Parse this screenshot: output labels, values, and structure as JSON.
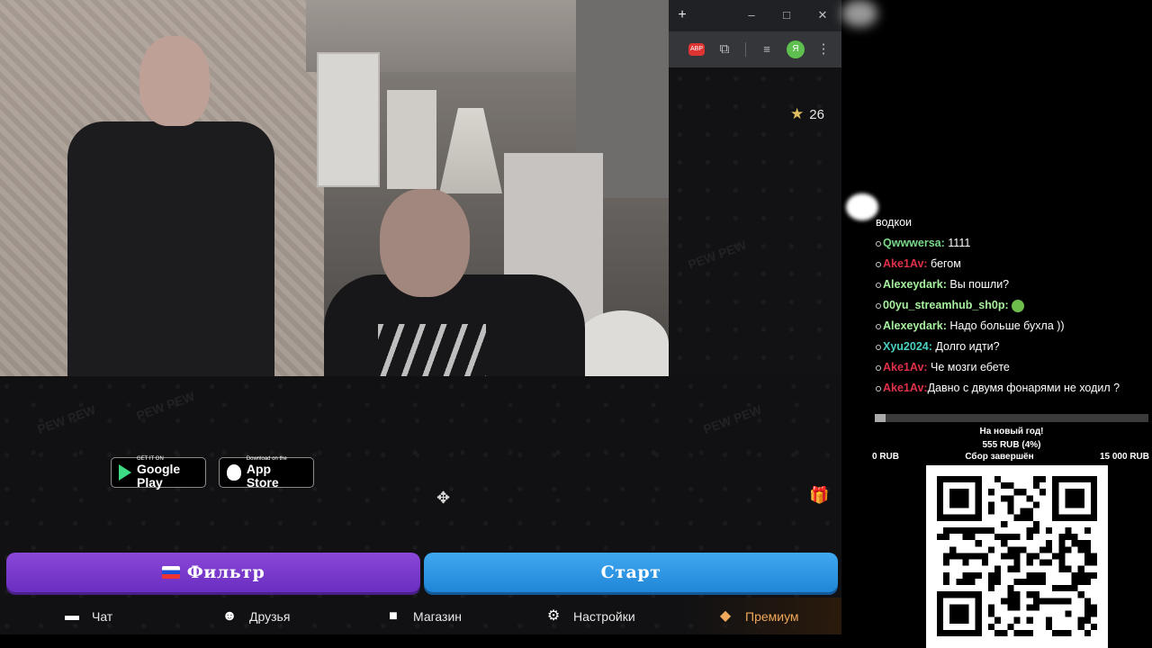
{
  "browser": {
    "new_tab": "+",
    "minimize": "–",
    "maximize": "□",
    "close": "✕",
    "ext_abp": "ABP",
    "profile_initial": "Я"
  },
  "app": {
    "score": "26",
    "google_play": {
      "small": "GET IT ON",
      "large": "Google Play"
    },
    "app_store": {
      "small": "Download on the",
      "large": "App Store"
    },
    "filter_button": "Фильтр",
    "start_button": "Старт",
    "nav": [
      {
        "label": "Чат",
        "icon": "chat-icon"
      },
      {
        "label": "Друзья",
        "icon": "friends-icon"
      },
      {
        "label": "Магазин",
        "icon": "shop-bag-icon"
      },
      {
        "label": "Настройки",
        "icon": "gear-icon"
      },
      {
        "label": "Премиум",
        "icon": "tag-icon"
      }
    ],
    "bg_text": "PEW PEW"
  },
  "chat": {
    "messages": [
      {
        "user": "",
        "text": "водкои",
        "color": "#ffffff"
      },
      {
        "user": "Qwwwersa:",
        "text": "1111",
        "color": "#7ad88a"
      },
      {
        "user": "Ake1Av:",
        "text": "бегом",
        "color": "#e0304a"
      },
      {
        "user": "Alexeydark:",
        "text": "Вы пошли?",
        "color": "#a8f0a0"
      },
      {
        "user": "00yu_streamhub_sh0p:",
        "text": "",
        "color": "#a8f0a0",
        "emote": true
      },
      {
        "user": "Alexeydark:",
        "text": "Надо больше бухла ))",
        "color": "#a8f0a0"
      },
      {
        "user": "Xyu2024:",
        "text": "Долго идти?",
        "color": "#4ad0c0"
      },
      {
        "user": "Ake1Av:",
        "text": "Че мозги ебете",
        "color": "#e0304a"
      },
      {
        "user": "Ake1Av:",
        "text": "Давно с двумя фонарями не ходил ?",
        "color": "#e0304a"
      }
    ]
  },
  "donation": {
    "title": "На новый год!",
    "amount": "555 RUB (4%)",
    "progress": 0.04,
    "min": "0 RUB",
    "status": "Сбор завершён",
    "max": "15 000 RUB"
  }
}
